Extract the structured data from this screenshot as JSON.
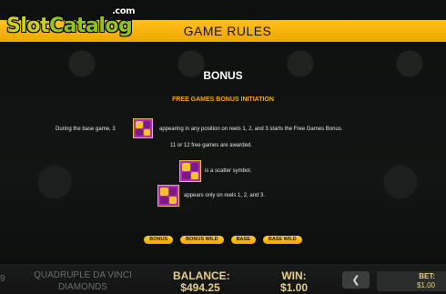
{
  "logo": {
    "slot": "Slot",
    "catalog": "Catalog",
    "com": ".com"
  },
  "header": {
    "title": "GAME RULES"
  },
  "bonus": {
    "title": "BONUS",
    "subtitle": "FREE GAMES BONUS INITIATION",
    "rule1_before": "During the base game, 3",
    "rule1_after": "appearing in any position on reels 1, 2, and 3 starts the Free Games Bonus.",
    "rule2": "11 or 12 free games are awarded.",
    "rule3": "is a scatter symbol.",
    "rule4": "appears only on reels 1, 2, and 3."
  },
  "tabs": [
    "BONUS",
    "BONUS WILD",
    "BASE",
    "BASE WILD"
  ],
  "footer": {
    "line_number": "9",
    "game_name": "QUADRUPLE DA VINCI DIAMONDS",
    "balance_label": "BALANCE:",
    "balance_value": "$494.25",
    "win_label": "WIN:",
    "win_value": "$1.00",
    "prev_arrow": "❮",
    "bet_label": "BET:",
    "bet_value": "$1.00"
  },
  "colors": {
    "header_bar": "#ffc11a",
    "subtitle": "#f4a70a",
    "footer_text": "#e6cf8a",
    "scatter_symbol": "#b12ab8"
  },
  "icons": {
    "scatter": "scatter-symbol-icon",
    "arrow": "chevron-left-icon"
  }
}
